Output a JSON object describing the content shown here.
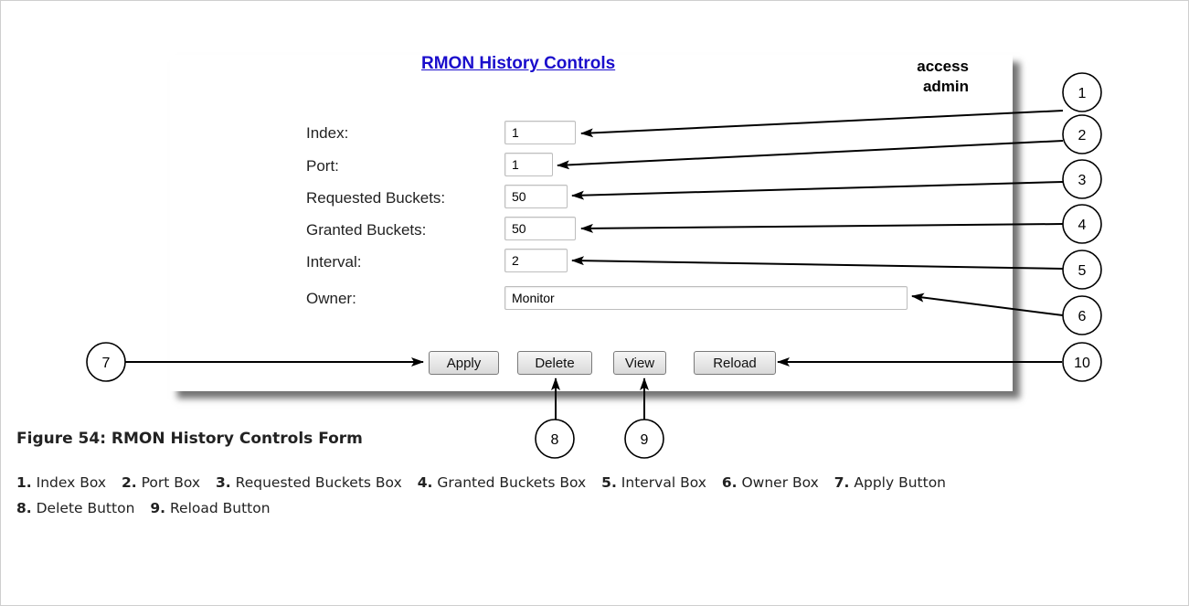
{
  "form": {
    "title": "RMON History Controls",
    "access_line1": "access",
    "access_line2": "admin",
    "fields": [
      {
        "label": "Index:",
        "value": "1"
      },
      {
        "label": "Port:",
        "value": "1"
      },
      {
        "label": "Requested Buckets:",
        "value": "50"
      },
      {
        "label": "Granted Buckets:",
        "value": "50"
      },
      {
        "label": "Interval:",
        "value": "2"
      },
      {
        "label": "Owner:",
        "value": "Monitor"
      }
    ],
    "buttons": {
      "apply": "Apply",
      "delete": "Delete",
      "view": "View",
      "reload": "Reload"
    }
  },
  "callouts": [
    "1",
    "2",
    "3",
    "4",
    "5",
    "6",
    "7",
    "8",
    "9",
    "10"
  ],
  "figure": {
    "caption": "Figure 54: RMON History Controls Form",
    "legend": [
      {
        "num": "1.",
        "text": "Index Box"
      },
      {
        "num": "2.",
        "text": "Port Box"
      },
      {
        "num": "3.",
        "text": "Requested Buckets Box"
      },
      {
        "num": "4.",
        "text": "Granted Buckets Box"
      },
      {
        "num": "5.",
        "text": "Interval Box"
      },
      {
        "num": "6.",
        "text": "Owner Box"
      },
      {
        "num": "7.",
        "text": "Apply Button"
      },
      {
        "num": "8.",
        "text": "Delete Button"
      },
      {
        "num": "9.",
        "text": "Reload Button"
      }
    ]
  },
  "colors": {
    "link": "#1a0dcc",
    "shadow": "#555555"
  }
}
